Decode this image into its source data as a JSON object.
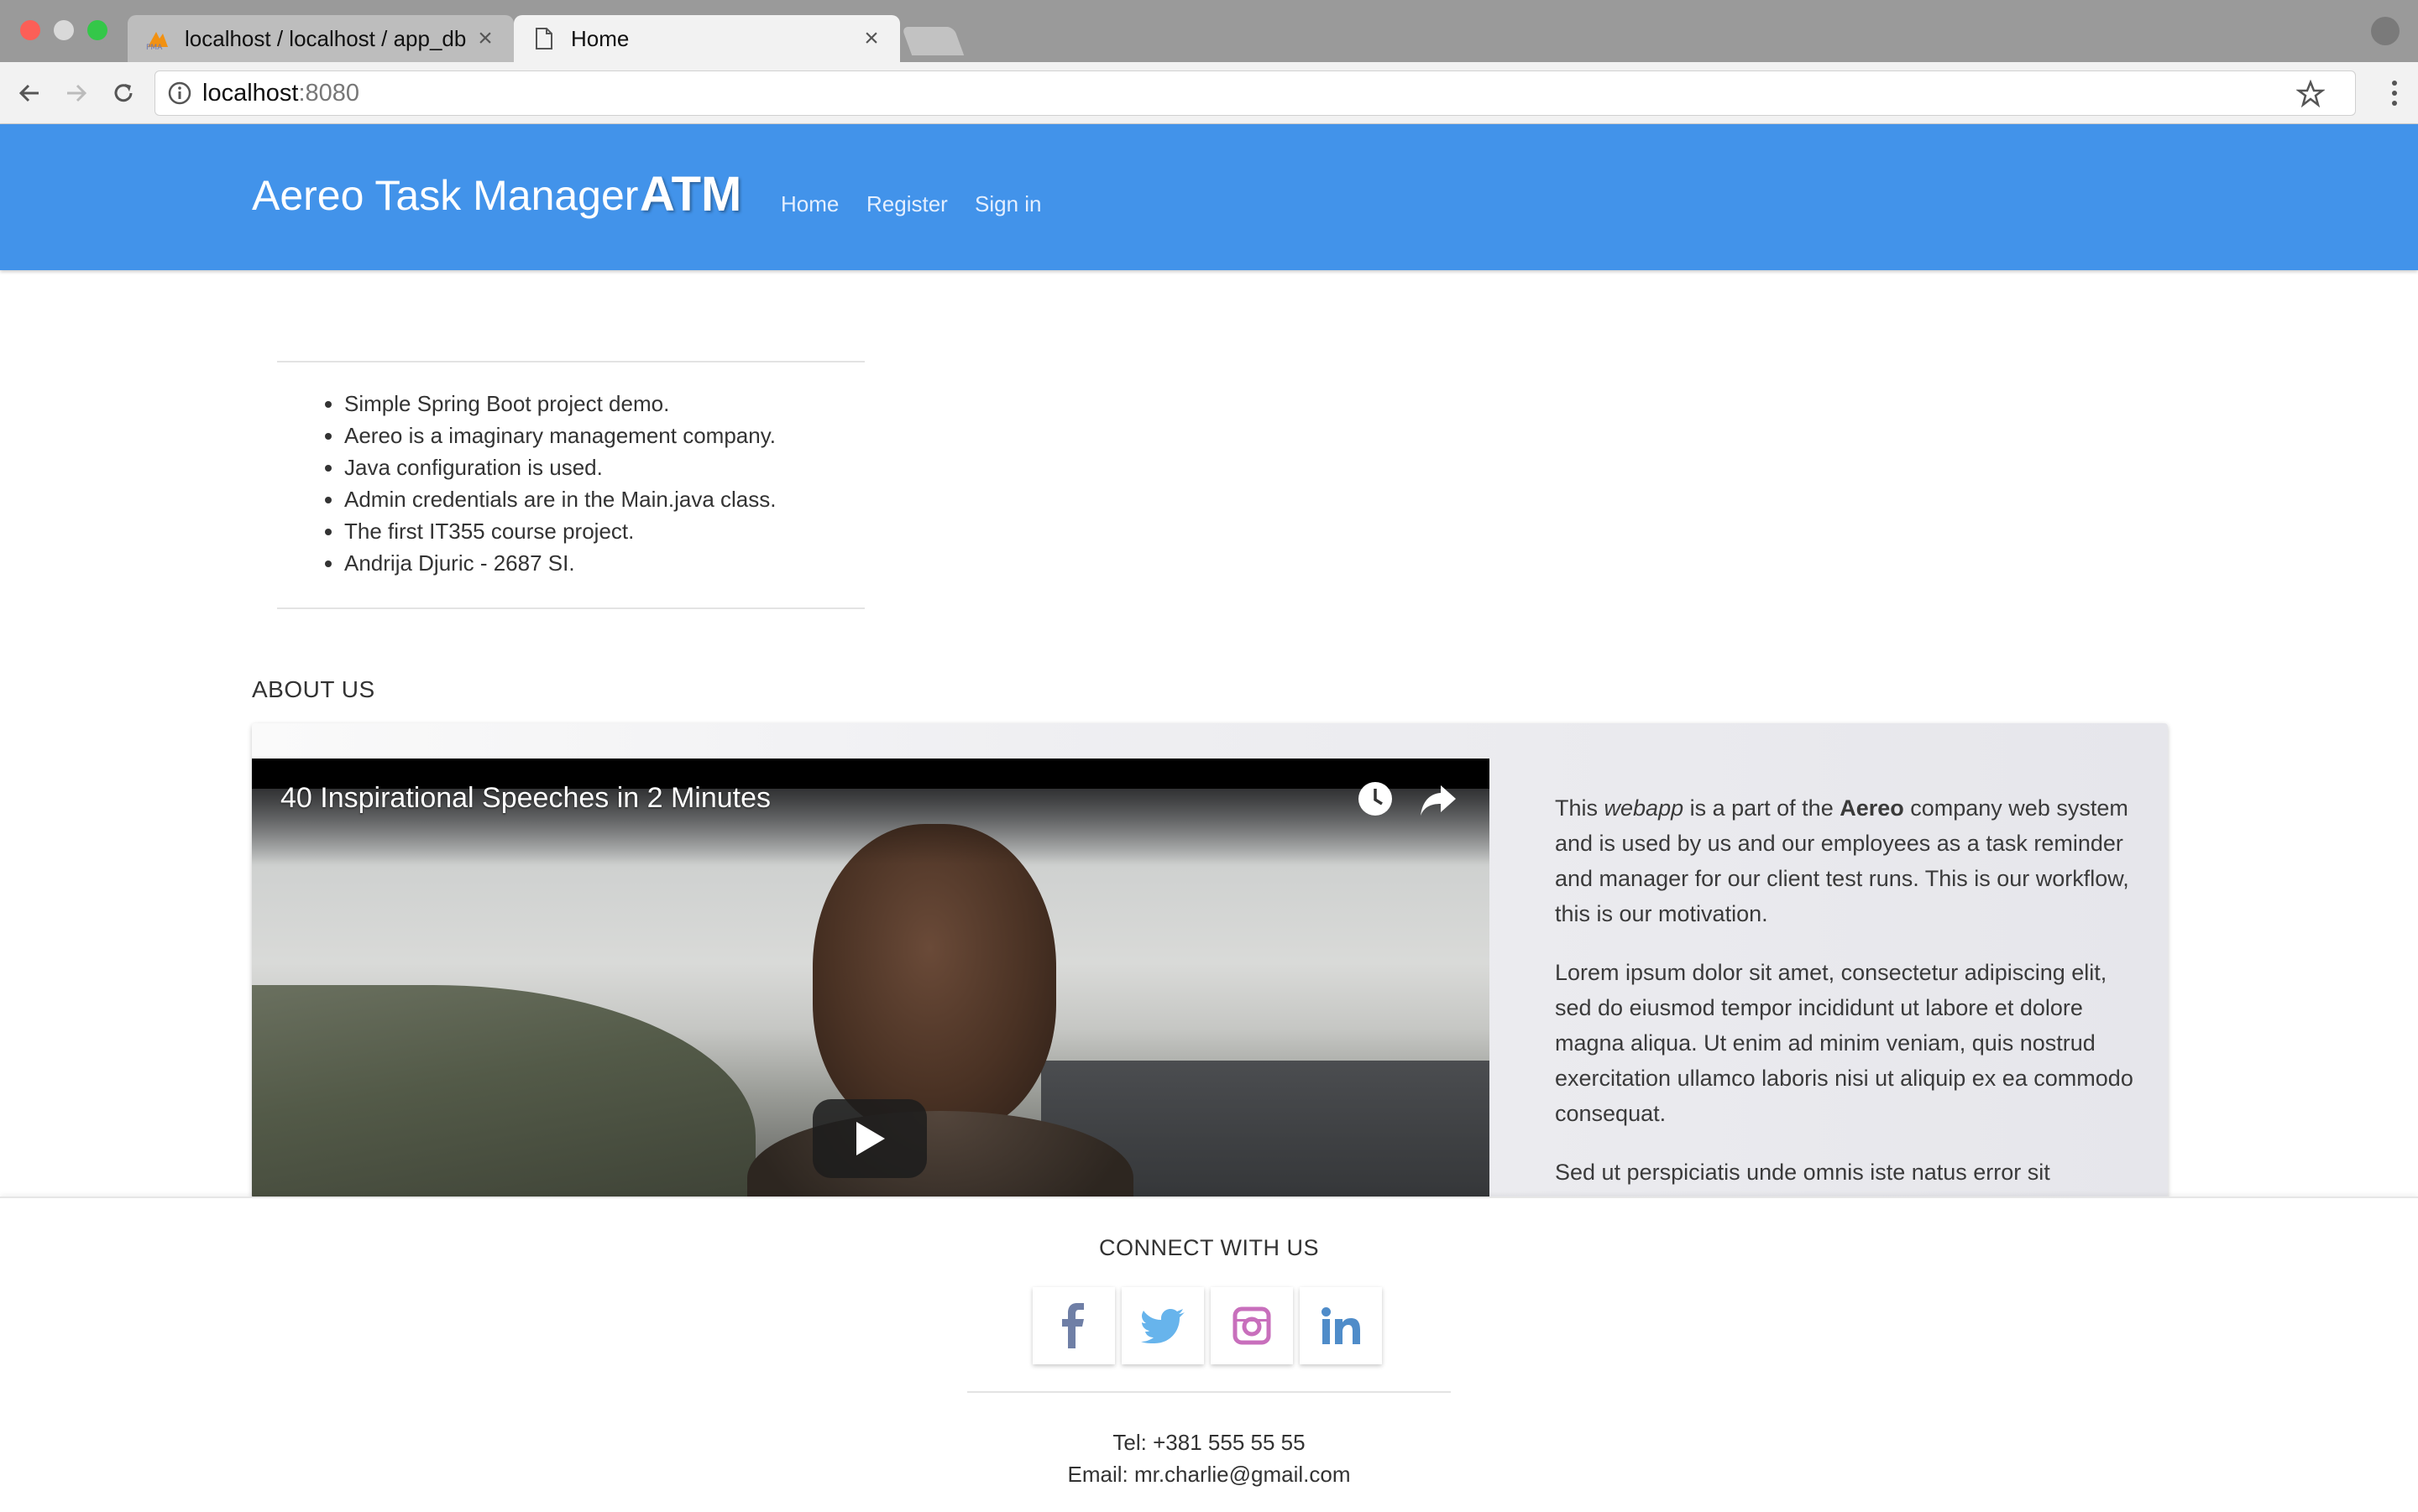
{
  "browser": {
    "tabs": [
      {
        "title": "localhost / localhost / app_db",
        "icon": "phpmyadmin-icon",
        "active": false
      },
      {
        "title": "Home",
        "icon": "page-icon",
        "active": true
      }
    ],
    "url_host": "localhost",
    "url_port": ":8080"
  },
  "nav": {
    "brand_name": "Aereo Task Manager",
    "brand_abbr": "ATM",
    "links": [
      "Home",
      "Register",
      "Sign in"
    ],
    "background": "#4293ea"
  },
  "info": {
    "items": [
      "Simple Spring Boot project demo.",
      "Aereo is a imaginary management company.",
      "Java configuration is used.",
      "Admin credentials are in the Main.java class.",
      "The first IT355 course project.",
      "Andrija Djuric - 2687 SI."
    ]
  },
  "about": {
    "heading": "ABOUT US",
    "video_title": "40 Inspirational Speeches in 2 Minutes",
    "p1_pre": "This ",
    "p1_em": "webapp",
    "p1_mid": " is a part of the ",
    "p1_strong": "Aereo",
    "p1_post": " company web system and is used by us and our employees as a task reminder and manager for our client test runs. This is our workflow, this is our motivation.",
    "p2": "Lorem ipsum dolor sit amet, consectetur adipiscing elit, sed do eiusmod tempor incididunt ut labore et dolore magna aliqua. Ut enim ad minim veniam, quis nostrud exercitation ullamco laboris nisi ut aliquip ex ea commodo consequat.",
    "p3": "Sed ut perspiciatis unde omnis iste natus error sit"
  },
  "footer": {
    "heading": "CONNECT WITH US",
    "social": [
      "facebook-icon",
      "twitter-icon",
      "instagram-icon",
      "linkedin-icon"
    ],
    "tel": "Tel: +381 555 55 55",
    "email": "Email: mr.charlie@gmail.com"
  }
}
